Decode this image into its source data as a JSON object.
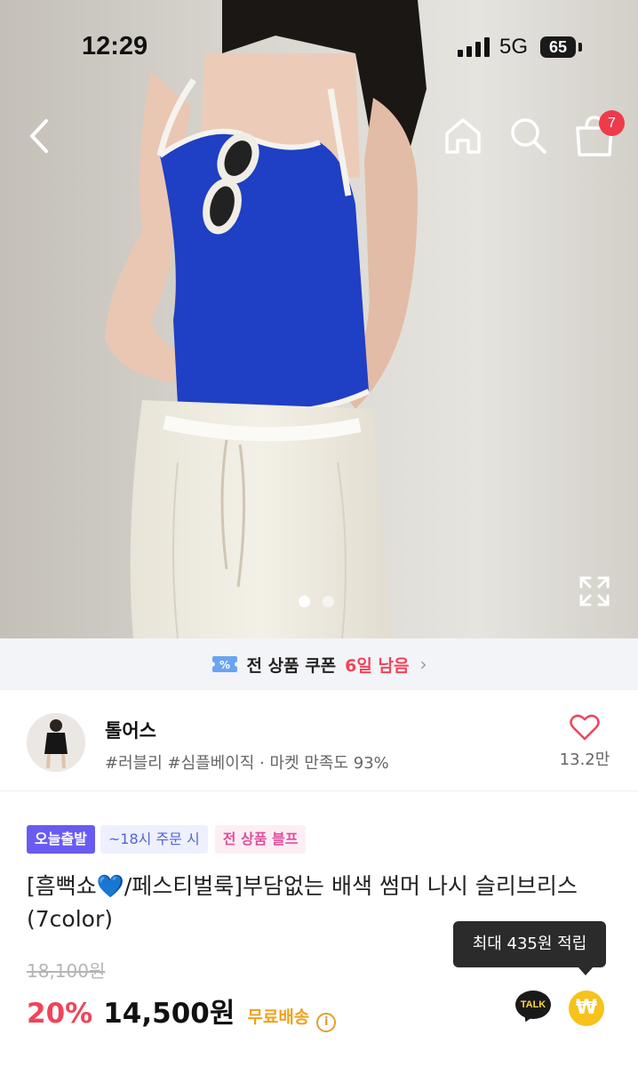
{
  "status_bar": {
    "time": "12:29",
    "network": "5G",
    "battery": "65"
  },
  "hero": {
    "cart_count": "7",
    "slide_count": 2,
    "active_slide": 1
  },
  "coupon_banner": {
    "label": "전 상품 쿠폰",
    "days_left": "6일 남음",
    "chevron": "›"
  },
  "shop": {
    "name": "톨어스",
    "tags": "#러블리 #심플베이직 · 마켓 만족도 93%",
    "like_count": "13.2만"
  },
  "product": {
    "badges": {
      "today_ship": "오늘출발",
      "order_deadline": "~18시 주문 시",
      "sale": "전 상품 블프"
    },
    "title": "[흠뻑쇼💙/페스티벌룩]부담없는 배색 썸머 나시 슬리브리스 (7color)",
    "original_price": "18,100원",
    "discount": "20%",
    "price": "14,500원",
    "shipping": "무료배송",
    "points_tooltip": "최대 435원 적립",
    "talk_label": "TALK",
    "point_symbol": "₩"
  },
  "colors": {
    "accent_red": "#f0445a",
    "badge_purple": "#6a5bf0",
    "shipping_orange": "#f0a21a",
    "top_blue": "#1f3fc4"
  },
  "icons": [
    "back-icon",
    "home-icon",
    "search-icon",
    "cart-icon",
    "expand-icon",
    "coupon-icon",
    "chevron-right-icon",
    "heart-icon",
    "info-icon",
    "talk-icon",
    "point-icon"
  ]
}
